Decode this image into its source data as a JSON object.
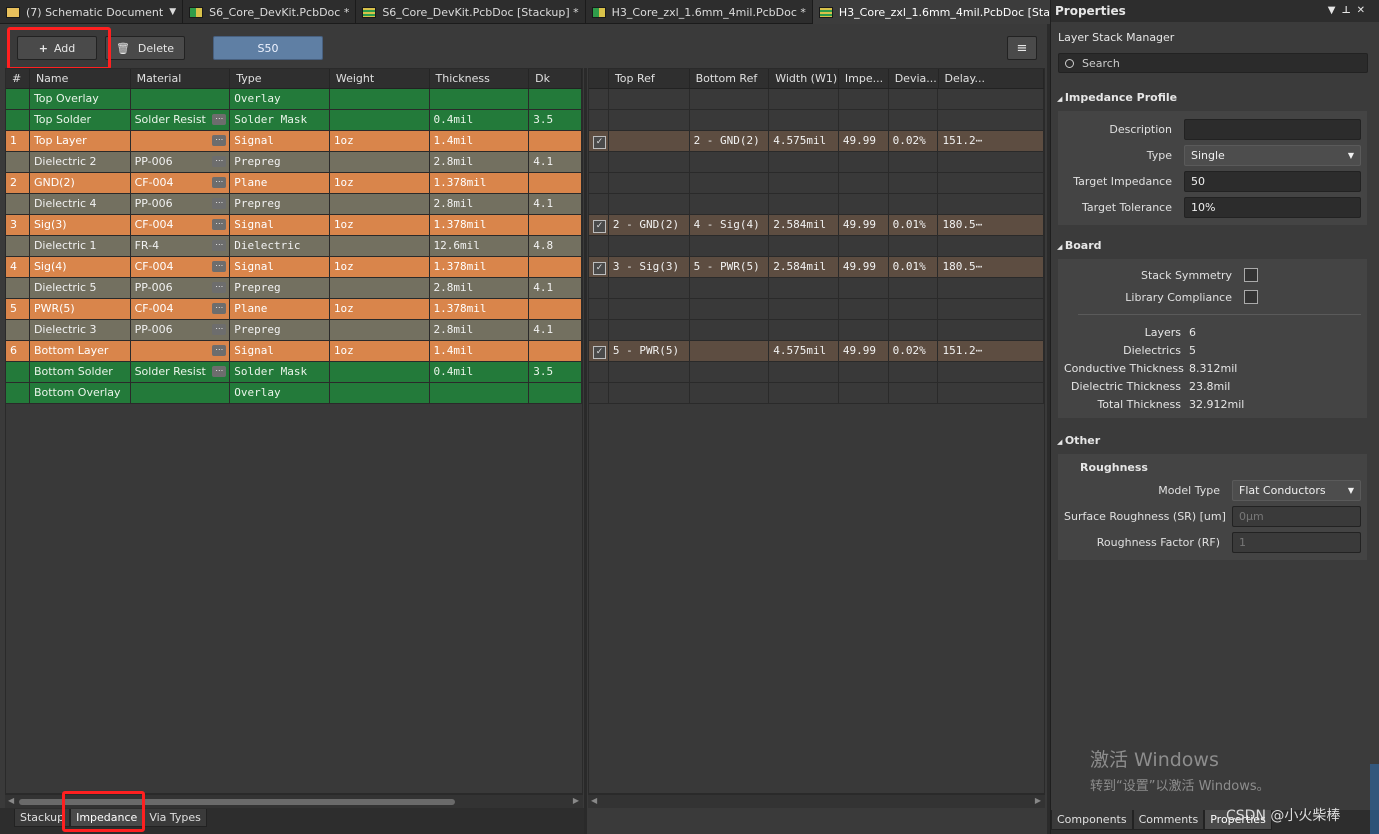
{
  "tabs": [
    {
      "label": "(7) Schematic Document",
      "icon": "schematic-icon",
      "has_dropdown": true
    },
    {
      "label": "S6_Core_DevKit.PcbDoc *",
      "icon": "pcb-icon"
    },
    {
      "label": "S6_Core_DevKit.PcbDoc [Stackup] *",
      "icon": "stackup-icon"
    },
    {
      "label": "H3_Core_zxl_1.6mm_4mil.PcbDoc *",
      "icon": "pcb-icon"
    },
    {
      "label": "H3_Core_zxl_1.6mm_4mil.PcbDoc [Stackup] *",
      "icon": "stackup-icon",
      "active": true
    }
  ],
  "toolbar": {
    "add_label": "Add",
    "delete_label": "Delete",
    "profile_label": "S50"
  },
  "left_table": {
    "headers": [
      "#",
      "Name",
      "Material",
      "Type",
      "Weight",
      "Thickness",
      "Dk"
    ],
    "rows": [
      {
        "num": "",
        "name": "Top Overlay",
        "material": "",
        "type": "Overlay",
        "weight": "",
        "thickness": "",
        "dk": "",
        "color": "green",
        "dots": false
      },
      {
        "num": "",
        "name": "Top Solder",
        "material": "Solder Resist",
        "type": "Solder Mask",
        "weight": "",
        "thickness": "0.4mil",
        "dk": "3.5",
        "color": "green",
        "dots": true
      },
      {
        "num": "1",
        "name": "Top Layer",
        "material": "",
        "type": "Signal",
        "weight": "1oz",
        "thickness": "1.4mil",
        "dk": "",
        "color": "orange",
        "dots": true
      },
      {
        "num": "",
        "name": "Dielectric 2",
        "material": "PP-006",
        "type": "Prepreg",
        "weight": "",
        "thickness": "2.8mil",
        "dk": "4.1",
        "color": "gray",
        "dots": true
      },
      {
        "num": "2",
        "name": "GND(2)",
        "material": "CF-004",
        "type": "Plane",
        "weight": "1oz",
        "thickness": "1.378mil",
        "dk": "",
        "color": "orange",
        "dots": true
      },
      {
        "num": "",
        "name": "Dielectric 4",
        "material": "PP-006",
        "type": "Prepreg",
        "weight": "",
        "thickness": "2.8mil",
        "dk": "4.1",
        "color": "gray",
        "dots": true
      },
      {
        "num": "3",
        "name": "Sig(3)",
        "material": "CF-004",
        "type": "Signal",
        "weight": "1oz",
        "thickness": "1.378mil",
        "dk": "",
        "color": "orange",
        "dots": true
      },
      {
        "num": "",
        "name": "Dielectric 1",
        "material": "FR-4",
        "type": "Dielectric",
        "weight": "",
        "thickness": "12.6mil",
        "dk": "4.8",
        "color": "gray",
        "dots": true
      },
      {
        "num": "4",
        "name": "Sig(4)",
        "material": "CF-004",
        "type": "Signal",
        "weight": "1oz",
        "thickness": "1.378mil",
        "dk": "",
        "color": "orange",
        "dots": true
      },
      {
        "num": "",
        "name": "Dielectric 5",
        "material": "PP-006",
        "type": "Prepreg",
        "weight": "",
        "thickness": "2.8mil",
        "dk": "4.1",
        "color": "gray",
        "dots": true
      },
      {
        "num": "5",
        "name": "PWR(5)",
        "material": "CF-004",
        "type": "Plane",
        "weight": "1oz",
        "thickness": "1.378mil",
        "dk": "",
        "color": "orange",
        "dots": true
      },
      {
        "num": "",
        "name": "Dielectric 3",
        "material": "PP-006",
        "type": "Prepreg",
        "weight": "",
        "thickness": "2.8mil",
        "dk": "4.1",
        "color": "gray",
        "dots": true
      },
      {
        "num": "6",
        "name": "Bottom Layer",
        "material": "",
        "type": "Signal",
        "weight": "1oz",
        "thickness": "1.4mil",
        "dk": "",
        "color": "orange",
        "dots": true
      },
      {
        "num": "",
        "name": "Bottom Solder",
        "material": "Solder Resist",
        "type": "Solder Mask",
        "weight": "",
        "thickness": "0.4mil",
        "dk": "3.5",
        "color": "green",
        "dots": true
      },
      {
        "num": "",
        "name": "Bottom Overlay",
        "material": "",
        "type": "Overlay",
        "weight": "",
        "thickness": "",
        "dk": "",
        "color": "green",
        "dots": false
      }
    ]
  },
  "right_table": {
    "headers": [
      "",
      "Top Ref",
      "Bottom Ref",
      "Width (W1)",
      "Impe...",
      "Devia...",
      "Delay..."
    ],
    "rows": [
      {
        "filled": false
      },
      {
        "filled": false
      },
      {
        "filled": true,
        "checked": true,
        "top_ref": "",
        "bottom_ref": "2 - GND(2)",
        "width": "4.575mil",
        "imp": "49.99",
        "dev": "0.02%",
        "delay": "151.2⋯"
      },
      {
        "filled": false
      },
      {
        "filled": false
      },
      {
        "filled": false
      },
      {
        "filled": true,
        "checked": true,
        "top_ref": "2 - GND(2)",
        "bottom_ref": "4 - Sig(4)",
        "width": "2.584mil",
        "imp": "49.99",
        "dev": "0.01%",
        "delay": "180.5⋯"
      },
      {
        "filled": false
      },
      {
        "filled": true,
        "checked": true,
        "top_ref": "3 - Sig(3)",
        "bottom_ref": "5 - PWR(5)",
        "width": "2.584mil",
        "imp": "49.99",
        "dev": "0.01%",
        "delay": "180.5⋯"
      },
      {
        "filled": false
      },
      {
        "filled": false
      },
      {
        "filled": false
      },
      {
        "filled": true,
        "checked": true,
        "top_ref": "5 - PWR(5)",
        "bottom_ref": "",
        "width": "4.575mil",
        "imp": "49.99",
        "dev": "0.02%",
        "delay": "151.2⋯"
      },
      {
        "filled": false
      },
      {
        "filled": false
      }
    ]
  },
  "bottom_tabs": [
    {
      "label": "Stackup"
    },
    {
      "label": "Impedance",
      "active": true
    },
    {
      "label": "Via Types"
    }
  ],
  "properties": {
    "title": "Properties",
    "subtitle": "Layer Stack Manager",
    "search_placeholder": "Search",
    "impedance_profile": {
      "heading": "Impedance Profile",
      "description_label": "Description",
      "description_value": "",
      "type_label": "Type",
      "type_value": "Single",
      "target_impedance_label": "Target Impedance",
      "target_impedance_value": "50",
      "target_tolerance_label": "Target Tolerance",
      "target_tolerance_value": "10%"
    },
    "board": {
      "heading": "Board",
      "stack_symmetry_label": "Stack Symmetry",
      "library_compliance_label": "Library Compliance",
      "layers_label": "Layers",
      "layers_value": "6",
      "dielectrics_label": "Dielectrics",
      "dielectrics_value": "5",
      "conductive_label": "Conductive Thickness",
      "conductive_value": "8.312mil",
      "dielectric_label": "Dielectric Thickness",
      "dielectric_value": "23.8mil",
      "total_label": "Total Thickness",
      "total_value": "32.912mil"
    },
    "other": {
      "heading": "Other",
      "roughness_heading": "Roughness",
      "model_type_label": "Model Type",
      "model_type_value": "Flat Conductors",
      "surface_roughness_label": "Surface Roughness (SR) [um]",
      "surface_roughness_value": "0μm",
      "roughness_factor_label": "Roughness Factor (RF)",
      "roughness_factor_value": "1"
    },
    "tabs": [
      {
        "label": "Components"
      },
      {
        "label": "Comments"
      },
      {
        "label": "Properties",
        "active": true
      }
    ]
  },
  "watermark": {
    "line1": "激活 Windows",
    "line2": "转到“设置”以激活 Windows。"
  },
  "csdn": "CSDN @小火柴棒"
}
